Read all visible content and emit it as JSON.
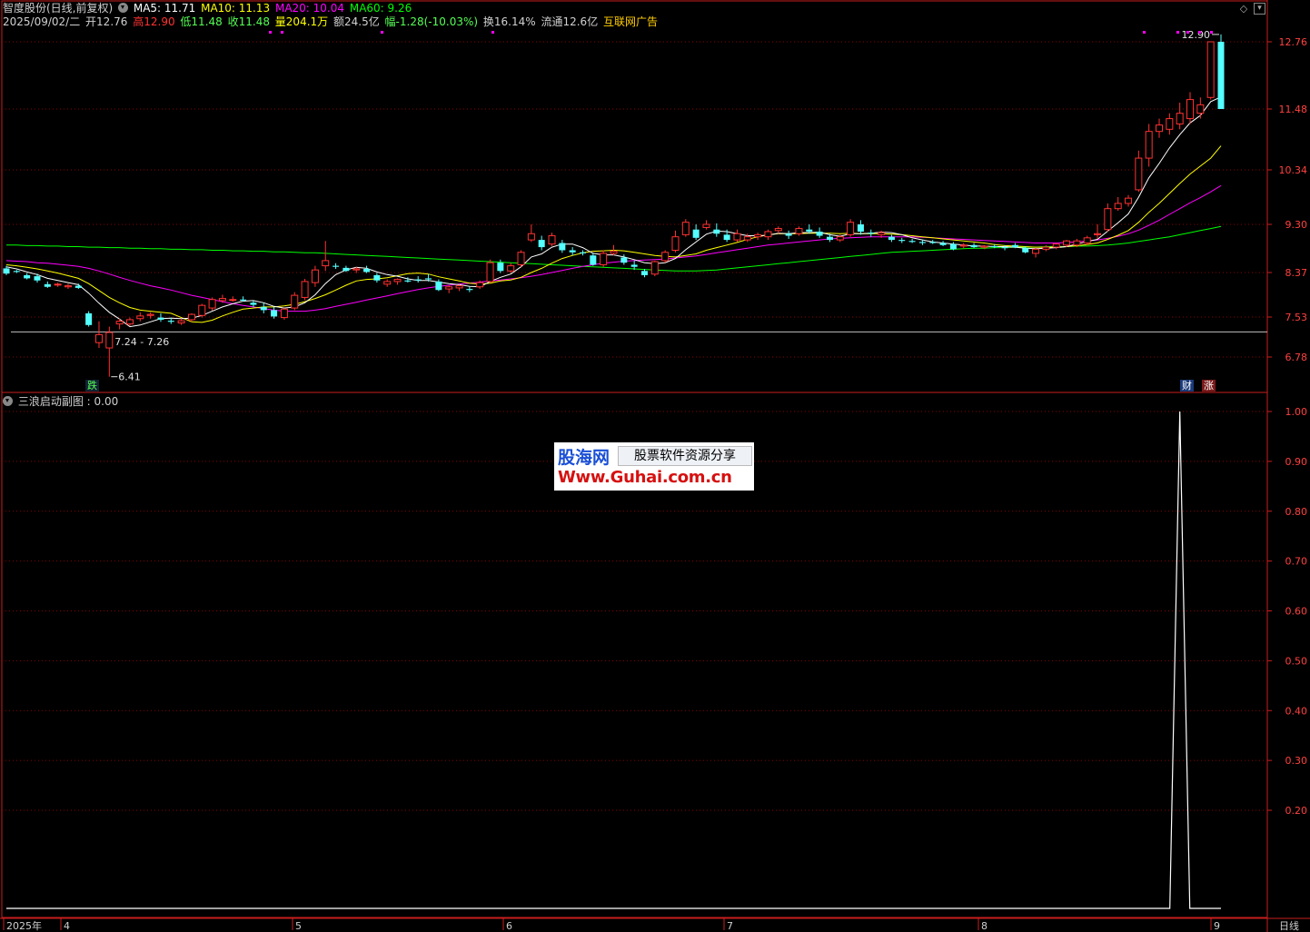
{
  "header": {
    "stock_name": "智度股份(日线,前复权)",
    "ma5": "MA5: 11.71",
    "ma10": "MA10: 11.13",
    "ma20": "MA20: 10.04",
    "ma60": "MA60: 9.26",
    "date": "2025/09/02/二",
    "open": "开12.76",
    "high": "高12.90",
    "low": "低11.48",
    "close": "收11.48",
    "volume": "量204.1万",
    "amount": "额24.5亿",
    "change": "幅-1.28(-10.03%)",
    "turnover": "换16.14%",
    "float": "流通12.6亿",
    "concept": "互联网广告"
  },
  "sub_header": {
    "indicator": "三浪启动副图 : 0.00"
  },
  "annotations": {
    "max_label": "12.90",
    "min_label": "6.41",
    "range_label": "7.24 - 7.26",
    "tag_down": "跌",
    "tag_fin": "财",
    "tag_up": "涨"
  },
  "watermark": {
    "brand": "股海网",
    "slogan": "股票软件资源分享",
    "url": "Www.Guhai.com.cn"
  },
  "colors": {
    "up": "#ff3232",
    "down": "#54ffff",
    "ma5": "#ffffff",
    "ma10": "#ffff00",
    "ma20": "#ff00ff",
    "ma60": "#00ff00",
    "grid": "#8b0000",
    "axis": "#c81e1e"
  },
  "chart_data": [
    {
      "type": "candlestick",
      "title": "",
      "ylim": [
        6.3,
        13.2
      ],
      "y_ticks": [
        "12.76",
        "11.48",
        "10.34",
        "9.30",
        "8.37",
        "7.53",
        "6.78"
      ],
      "x_labels": [
        "2025年",
        "4",
        "5",
        "6",
        "7",
        "8",
        "9"
      ],
      "support_line": 7.25,
      "ohlc": [
        [
          8.45,
          8.5,
          8.32,
          8.35
        ],
        [
          8.4,
          8.42,
          8.36,
          8.38
        ],
        [
          8.32,
          8.36,
          8.24,
          8.26
        ],
        [
          8.3,
          8.35,
          8.18,
          8.22
        ],
        [
          8.15,
          8.2,
          8.08,
          8.1
        ],
        [
          8.14,
          8.18,
          8.1,
          8.15
        ],
        [
          8.1,
          8.16,
          8.06,
          8.12
        ],
        [
          8.12,
          8.16,
          8.06,
          8.08
        ],
        [
          7.6,
          7.64,
          7.35,
          7.38
        ],
        [
          7.05,
          7.45,
          6.95,
          7.2
        ],
        [
          6.95,
          7.35,
          6.41,
          7.24
        ],
        [
          7.4,
          7.5,
          7.3,
          7.45
        ],
        [
          7.4,
          7.52,
          7.36,
          7.48
        ],
        [
          7.5,
          7.62,
          7.45,
          7.55
        ],
        [
          7.56,
          7.62,
          7.5,
          7.58
        ],
        [
          7.52,
          7.6,
          7.44,
          7.48
        ],
        [
          7.46,
          7.52,
          7.4,
          7.44
        ],
        [
          7.42,
          7.5,
          7.38,
          7.46
        ],
        [
          7.48,
          7.6,
          7.44,
          7.58
        ],
        [
          7.56,
          7.78,
          7.52,
          7.75
        ],
        [
          7.7,
          7.9,
          7.65,
          7.86
        ],
        [
          7.84,
          7.95,
          7.8,
          7.88
        ],
        [
          7.85,
          7.92,
          7.82,
          7.86
        ],
        [
          7.86,
          7.92,
          7.82,
          7.84
        ],
        [
          7.8,
          7.84,
          7.72,
          7.76
        ],
        [
          7.72,
          7.8,
          7.6,
          7.66
        ],
        [
          7.66,
          7.72,
          7.5,
          7.54
        ],
        [
          7.52,
          7.7,
          7.48,
          7.68
        ],
        [
          7.7,
          8.0,
          7.66,
          7.94
        ],
        [
          7.9,
          8.25,
          7.85,
          8.2
        ],
        [
          8.18,
          8.5,
          8.1,
          8.42
        ],
        [
          8.5,
          8.98,
          8.4,
          8.6
        ],
        [
          8.5,
          8.55,
          8.44,
          8.48
        ],
        [
          8.46,
          8.5,
          8.38,
          8.4
        ],
        [
          8.42,
          8.48,
          8.36,
          8.44
        ],
        [
          8.44,
          8.5,
          8.36,
          8.38
        ],
        [
          8.32,
          8.36,
          8.18,
          8.22
        ],
        [
          8.15,
          8.24,
          8.1,
          8.2
        ],
        [
          8.2,
          8.26,
          8.14,
          8.24
        ],
        [
          8.22,
          8.28,
          8.18,
          8.2
        ],
        [
          8.24,
          8.3,
          8.18,
          8.22
        ],
        [
          8.26,
          8.34,
          8.2,
          8.24
        ],
        [
          8.2,
          8.24,
          8.02,
          8.04
        ],
        [
          8.06,
          8.12,
          7.98,
          8.1
        ],
        [
          8.08,
          8.14,
          8.02,
          8.12
        ],
        [
          8.06,
          8.1,
          8.0,
          8.04
        ],
        [
          8.1,
          8.22,
          8.06,
          8.18
        ],
        [
          8.2,
          8.62,
          8.18,
          8.56
        ],
        [
          8.56,
          8.62,
          8.36,
          8.4
        ],
        [
          8.4,
          8.55,
          8.36,
          8.5
        ],
        [
          8.52,
          8.8,
          8.48,
          8.76
        ],
        [
          9.0,
          9.3,
          8.96,
          9.12
        ],
        [
          9.0,
          9.08,
          8.8,
          8.86
        ],
        [
          8.92,
          9.14,
          8.88,
          9.08
        ],
        [
          8.94,
          9.0,
          8.75,
          8.8
        ],
        [
          8.8,
          8.86,
          8.7,
          8.76
        ],
        [
          8.76,
          8.8,
          8.7,
          8.74
        ],
        [
          8.7,
          8.74,
          8.5,
          8.52
        ],
        [
          8.52,
          8.8,
          8.48,
          8.74
        ],
        [
          8.74,
          8.9,
          8.7,
          8.78
        ],
        [
          8.66,
          8.72,
          8.52,
          8.56
        ],
        [
          8.52,
          8.6,
          8.42,
          8.48
        ],
        [
          8.4,
          8.44,
          8.28,
          8.32
        ],
        [
          8.34,
          8.6,
          8.3,
          8.58
        ],
        [
          8.6,
          8.8,
          8.56,
          8.76
        ],
        [
          8.8,
          9.18,
          8.76,
          9.06
        ],
        [
          9.1,
          9.4,
          9.06,
          9.34
        ],
        [
          9.2,
          9.3,
          9.0,
          9.04
        ],
        [
          9.24,
          9.38,
          9.2,
          9.3
        ],
        [
          9.2,
          9.32,
          9.06,
          9.12
        ],
        [
          9.1,
          9.2,
          8.96,
          9.0
        ],
        [
          9.0,
          9.2,
          8.96,
          9.12
        ],
        [
          9.0,
          9.12,
          8.96,
          9.06
        ],
        [
          9.06,
          9.14,
          9.0,
          9.1
        ],
        [
          9.06,
          9.2,
          9.0,
          9.16
        ],
        [
          9.18,
          9.26,
          9.12,
          9.22
        ],
        [
          9.12,
          9.18,
          9.02,
          9.08
        ],
        [
          9.12,
          9.26,
          9.08,
          9.22
        ],
        [
          9.2,
          9.3,
          9.12,
          9.16
        ],
        [
          9.16,
          9.24,
          9.04,
          9.08
        ],
        [
          9.06,
          9.12,
          8.96,
          9.0
        ],
        [
          9.0,
          9.1,
          8.96,
          9.06
        ],
        [
          9.1,
          9.4,
          9.06,
          9.34
        ],
        [
          9.3,
          9.38,
          9.1,
          9.16
        ],
        [
          9.14,
          9.2,
          9.06,
          9.12
        ],
        [
          9.1,
          9.18,
          9.04,
          9.14
        ],
        [
          9.06,
          9.1,
          8.96,
          9.0
        ],
        [
          9.0,
          9.04,
          8.94,
          8.98
        ],
        [
          8.98,
          9.02,
          8.94,
          8.96
        ],
        [
          8.96,
          9.0,
          8.9,
          8.94
        ],
        [
          8.96,
          9.0,
          8.92,
          8.94
        ],
        [
          8.94,
          8.98,
          8.88,
          8.9
        ],
        [
          8.92,
          8.96,
          8.8,
          8.82
        ],
        [
          8.88,
          8.94,
          8.84,
          8.9
        ],
        [
          8.9,
          8.94,
          8.84,
          8.86
        ],
        [
          8.86,
          8.9,
          8.82,
          8.88
        ],
        [
          8.88,
          8.92,
          8.84,
          8.86
        ],
        [
          8.86,
          8.9,
          8.8,
          8.84
        ],
        [
          8.9,
          8.94,
          8.84,
          8.86
        ],
        [
          8.84,
          8.88,
          8.74,
          8.76
        ],
        [
          8.74,
          8.84,
          8.66,
          8.82
        ],
        [
          8.82,
          8.9,
          8.78,
          8.86
        ],
        [
          8.86,
          8.94,
          8.82,
          8.92
        ],
        [
          8.9,
          9.0,
          8.86,
          8.98
        ],
        [
          8.9,
          9.02,
          8.86,
          8.98
        ],
        [
          8.94,
          9.08,
          8.9,
          9.04
        ],
        [
          9.1,
          9.3,
          9.02,
          9.12
        ],
        [
          9.2,
          9.7,
          9.16,
          9.6
        ],
        [
          9.6,
          9.82,
          9.56,
          9.7
        ],
        [
          9.7,
          9.86,
          9.64,
          9.8
        ],
        [
          9.96,
          10.7,
          9.92,
          10.56
        ],
        [
          10.56,
          11.2,
          10.4,
          11.06
        ],
        [
          11.06,
          11.3,
          10.94,
          11.18
        ],
        [
          11.1,
          11.4,
          11.0,
          11.3
        ],
        [
          11.2,
          11.6,
          11.1,
          11.4
        ],
        [
          11.3,
          11.8,
          11.2,
          11.66
        ],
        [
          11.4,
          11.7,
          11.3,
          11.56
        ],
        [
          11.7,
          12.76,
          11.66,
          12.76
        ],
        [
          12.76,
          12.9,
          11.48,
          11.48
        ]
      ],
      "ma5": [
        8.48,
        8.44,
        8.38,
        8.33,
        8.26,
        8.22,
        8.18,
        8.14,
        7.98,
        7.79,
        7.62,
        7.49,
        7.35,
        7.38,
        7.44,
        7.5,
        7.51,
        7.5,
        7.51,
        7.56,
        7.64,
        7.72,
        7.78,
        7.83,
        7.84,
        7.8,
        7.73,
        7.7,
        7.72,
        7.8,
        7.95,
        8.16,
        8.33,
        8.42,
        8.47,
        8.45,
        8.38,
        8.33,
        8.3,
        8.25,
        8.22,
        8.22,
        8.19,
        8.16,
        8.14,
        8.11,
        8.1,
        8.2,
        8.28,
        8.34,
        8.48,
        8.67,
        8.73,
        8.86,
        8.92,
        8.92,
        8.85,
        8.74,
        8.71,
        8.71,
        8.67,
        8.62,
        8.56,
        8.54,
        8.56,
        8.64,
        8.81,
        8.96,
        9.11,
        9.17,
        9.16,
        9.12,
        9.08,
        9.08,
        9.09,
        9.13,
        9.12,
        9.14,
        9.14,
        9.15,
        9.1,
        9.07,
        9.12,
        9.12,
        9.13,
        9.15,
        9.14,
        9.1,
        9.04,
        9.0,
        8.96,
        8.94,
        8.92,
        8.9,
        8.88,
        8.88,
        8.87,
        8.87,
        8.86,
        8.84,
        8.83,
        8.84,
        8.85,
        8.87,
        8.92,
        8.97,
        9.01,
        9.17,
        9.33,
        9.5,
        9.82,
        10.19,
        10.46,
        10.75,
        11.0,
        11.22,
        11.36,
        11.62,
        11.71
      ],
      "ma10": [
        8.52,
        8.5,
        8.47,
        8.44,
        8.4,
        8.36,
        8.31,
        8.26,
        8.16,
        8.03,
        7.9,
        7.8,
        7.71,
        7.66,
        7.64,
        7.62,
        7.6,
        7.52,
        7.44,
        7.43,
        7.47,
        7.55,
        7.62,
        7.68,
        7.7,
        7.72,
        7.72,
        7.74,
        7.77,
        7.82,
        7.88,
        7.95,
        8.04,
        8.13,
        8.21,
        8.24,
        8.25,
        8.27,
        8.31,
        8.35,
        8.36,
        8.34,
        8.29,
        8.25,
        8.21,
        8.17,
        8.15,
        8.17,
        8.21,
        8.23,
        8.28,
        8.37,
        8.45,
        8.55,
        8.64,
        8.7,
        8.75,
        8.78,
        8.79,
        8.8,
        8.79,
        8.76,
        8.73,
        8.7,
        8.68,
        8.67,
        8.7,
        8.73,
        8.8,
        8.85,
        8.9,
        8.95,
        9.01,
        9.06,
        9.1,
        9.12,
        9.12,
        9.12,
        9.13,
        9.13,
        9.13,
        9.12,
        9.13,
        9.12,
        9.12,
        9.12,
        9.11,
        9.1,
        9.08,
        9.06,
        9.04,
        9.02,
        9.0,
        8.98,
        8.96,
        8.94,
        8.91,
        8.89,
        8.88,
        8.87,
        8.86,
        8.86,
        8.86,
        8.87,
        8.89,
        8.91,
        8.94,
        9.01,
        9.09,
        9.18,
        9.34,
        9.53,
        9.7,
        9.89,
        10.08,
        10.26,
        10.41,
        10.56,
        10.79
      ],
      "ma20": [
        8.6,
        8.59,
        8.58,
        8.56,
        8.55,
        8.53,
        8.51,
        8.49,
        8.45,
        8.4,
        8.34,
        8.28,
        8.22,
        8.17,
        8.12,
        8.08,
        8.04,
        7.99,
        7.94,
        7.9,
        7.86,
        7.82,
        7.78,
        7.75,
        7.72,
        7.69,
        7.66,
        7.64,
        7.64,
        7.64,
        7.66,
        7.69,
        7.73,
        7.77,
        7.81,
        7.85,
        7.89,
        7.93,
        7.97,
        8.01,
        8.05,
        8.08,
        8.11,
        8.13,
        8.15,
        8.17,
        8.19,
        8.21,
        8.23,
        8.25,
        8.27,
        8.3,
        8.33,
        8.37,
        8.41,
        8.45,
        8.49,
        8.52,
        8.55,
        8.57,
        8.59,
        8.6,
        8.61,
        8.62,
        8.63,
        8.65,
        8.67,
        8.69,
        8.72,
        8.75,
        8.78,
        8.81,
        8.84,
        8.87,
        8.9,
        8.92,
        8.94,
        8.96,
        8.98,
        9.0,
        9.02,
        9.03,
        9.04,
        9.05,
        9.06,
        9.06,
        9.06,
        9.06,
        9.06,
        9.05,
        9.04,
        9.03,
        9.02,
        9.01,
        9.0,
        8.99,
        8.98,
        8.97,
        8.96,
        8.95,
        8.94,
        8.94,
        8.94,
        8.95,
        8.96,
        8.98,
        9.0,
        9.03,
        9.07,
        9.12,
        9.19,
        9.28,
        9.38,
        9.49,
        9.6,
        9.71,
        9.81,
        9.92,
        10.04
      ],
      "ma60": [
        8.9,
        8.9,
        8.89,
        8.89,
        8.88,
        8.88,
        8.87,
        8.87,
        8.86,
        8.86,
        8.85,
        8.85,
        8.84,
        8.84,
        8.83,
        8.83,
        8.82,
        8.82,
        8.81,
        8.81,
        8.8,
        8.8,
        8.79,
        8.79,
        8.78,
        8.78,
        8.77,
        8.77,
        8.76,
        8.75,
        8.75,
        8.74,
        8.73,
        8.72,
        8.71,
        8.7,
        8.69,
        8.68,
        8.67,
        8.66,
        8.65,
        8.64,
        8.63,
        8.62,
        8.61,
        8.6,
        8.59,
        8.58,
        8.57,
        8.56,
        8.55,
        8.54,
        8.53,
        8.52,
        8.51,
        8.5,
        8.49,
        8.48,
        8.47,
        8.46,
        8.45,
        8.44,
        8.43,
        8.42,
        8.41,
        8.4,
        8.4,
        8.4,
        8.41,
        8.42,
        8.44,
        8.46,
        8.48,
        8.5,
        8.52,
        8.54,
        8.56,
        8.58,
        8.6,
        8.62,
        8.64,
        8.66,
        8.68,
        8.7,
        8.72,
        8.74,
        8.76,
        8.77,
        8.78,
        8.79,
        8.8,
        8.81,
        8.82,
        8.83,
        8.84,
        8.84,
        8.85,
        8.85,
        8.86,
        8.86,
        8.86,
        8.87,
        8.87,
        8.87,
        8.88,
        8.88,
        8.89,
        8.9,
        8.92,
        8.94,
        8.97,
        9.0,
        9.03,
        9.06,
        9.1,
        9.14,
        9.18,
        9.22,
        9.26
      ]
    },
    {
      "type": "line",
      "title": "三浪启动副图",
      "ylim": [
        0.1,
        1.05
      ],
      "y_ticks": [
        "1.00",
        "0.90",
        "0.80",
        "0.70",
        "0.60",
        "0.50",
        "0.40",
        "0.30",
        "0.20"
      ],
      "spike_index": 114,
      "spike_value": 1.0,
      "baseline": 0.0
    }
  ]
}
